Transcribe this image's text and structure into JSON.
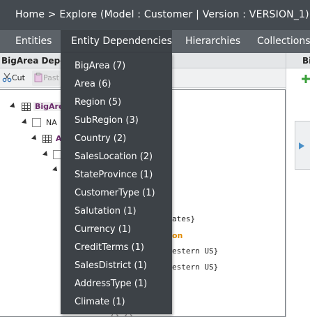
{
  "header": {
    "breadcrumb": "Home > Explore (Model : Customer | Version : VERSION_1)"
  },
  "nav": {
    "tabs": [
      {
        "label": "Entities"
      },
      {
        "label": "Entity Dependencies"
      },
      {
        "label": "Hierarchies"
      },
      {
        "label": "Collections"
      }
    ]
  },
  "left_panel": {
    "title": "BigArea Depe",
    "toolbar": {
      "cut_label": "Cut",
      "paste_label": "Past"
    }
  },
  "tree": {
    "nodes": [
      {
        "label": "BigAre"
      },
      {
        "label": "NA"
      },
      {
        "label": "A"
      }
    ],
    "fragments": [
      "ates}",
      "on",
      "estern US}",
      "estern US}",
      "{} {}"
    ]
  },
  "right_panel": {
    "title": "Bi"
  },
  "dependencies_menu": {
    "items": [
      {
        "label": "BigArea (7)"
      },
      {
        "label": "Area (6)"
      },
      {
        "label": "Region (5)"
      },
      {
        "label": "SubRegion (3)"
      },
      {
        "label": "Country (2)"
      },
      {
        "label": "SalesLocation (2)"
      },
      {
        "label": "StateProvince (1)"
      },
      {
        "label": "CustomerType (1)"
      },
      {
        "label": "Salutation (1)"
      },
      {
        "label": "Currency (1)"
      },
      {
        "label": "CreditTerms (1)"
      },
      {
        "label": "SalesDistrict (1)"
      },
      {
        "label": "AddressType (1)"
      },
      {
        "label": "Climate (1)"
      }
    ]
  },
  "colors": {
    "topbar": "#444a50",
    "navbar": "#5c6268",
    "menu_bg": "#3d4247",
    "tree_highlight": "#6b2a6b",
    "tree_orange": "#e08a00"
  }
}
